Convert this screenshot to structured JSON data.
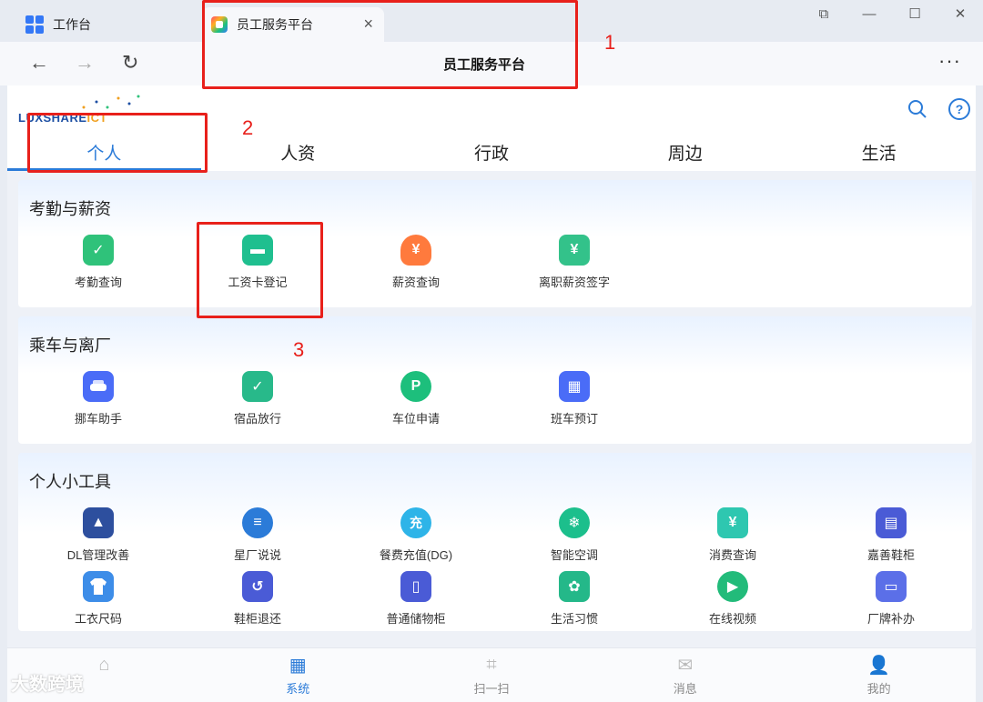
{
  "browser": {
    "tabs": [
      {
        "label": "工作台"
      },
      {
        "label": "员工服务平台"
      }
    ],
    "close_symbol": "×",
    "page_title": "员工服务平台",
    "more_symbol": "···",
    "nav": {
      "back": "←",
      "forward": "→",
      "reload": "↻"
    },
    "window_controls": {
      "restore": "⧉",
      "minimize": "—",
      "maximize": "☐",
      "close": "✕"
    }
  },
  "header": {
    "logo_main": "LUXSHARE",
    "logo_suffix": "ICT",
    "search_symbol": "⌕",
    "help_symbol": "?"
  },
  "top_tabs": [
    {
      "label": "个人",
      "active": true
    },
    {
      "label": "人资",
      "active": false
    },
    {
      "label": "行政",
      "active": false
    },
    {
      "label": "周边",
      "active": false
    },
    {
      "label": "生活",
      "active": false
    }
  ],
  "sections": [
    {
      "title": "考勤与薪资",
      "items": [
        {
          "label": "考勤查询",
          "icon": "calendar-check-icon",
          "glyph": "✓",
          "color": "#2fc27a"
        },
        {
          "label": "工资卡登记",
          "icon": "bank-card-icon",
          "glyph": "▬",
          "color": "#1fbf8f"
        },
        {
          "label": "薪资查询",
          "icon": "money-bag-icon",
          "glyph": "¥",
          "color": "#ff7a3d"
        },
        {
          "label": "离职薪资签字",
          "icon": "sign-document-icon",
          "glyph": "¥",
          "color": "#33c28a"
        }
      ]
    },
    {
      "title": "乘车与离厂",
      "items": [
        {
          "label": "挪车助手",
          "icon": "car-icon",
          "glyph": "🚗",
          "color": "#4a6cf7"
        },
        {
          "label": "宿品放行",
          "icon": "package-check-icon",
          "glyph": "✓",
          "color": "#28b98a"
        },
        {
          "label": "车位申请",
          "icon": "parking-icon",
          "glyph": "P",
          "color": "#1dbf7c"
        },
        {
          "label": "班车预订",
          "icon": "bus-icon",
          "glyph": "▦",
          "color": "#4a6cf7"
        }
      ]
    },
    {
      "title": "个人小工具",
      "items": [
        {
          "label": "DL管理改善",
          "icon": "building-chart-icon",
          "glyph": "▲",
          "color": "#2d4f9e"
        },
        {
          "label": "星厂说说",
          "icon": "chat-bubble-icon",
          "glyph": "≡",
          "color": "#2b7bd8"
        },
        {
          "label": "餐费充值(DG)",
          "icon": "recharge-icon",
          "glyph": "充",
          "color": "#2eb4e8"
        },
        {
          "label": "智能空调",
          "icon": "air-conditioner-icon",
          "glyph": "❄",
          "color": "#1cbf8c"
        },
        {
          "label": "消费查询",
          "icon": "receipt-icon",
          "glyph": "¥",
          "color": "#2ec7b0"
        },
        {
          "label": "嘉善鞋柜",
          "icon": "cabinet-icon",
          "glyph": "▤",
          "color": "#4a5bd6"
        },
        {
          "label": "工衣尺码",
          "icon": "uniform-icon",
          "glyph": "👕",
          "color": "#3d8de8"
        },
        {
          "label": "鞋柜退还",
          "icon": "cabinet-return-icon",
          "glyph": "↺",
          "color": "#4a5bd6"
        },
        {
          "label": "普通储物柜",
          "icon": "locker-key-icon",
          "glyph": "▯",
          "color": "#4a5bd6"
        },
        {
          "label": "生活习惯",
          "icon": "plant-icon",
          "glyph": "✿",
          "color": "#24b889"
        },
        {
          "label": "在线视频",
          "icon": "video-cloud-icon",
          "glyph": "▶",
          "color": "#22bb7a"
        },
        {
          "label": "厂牌补办",
          "icon": "id-card-icon",
          "glyph": "▭",
          "color": "#5b6fe8"
        }
      ]
    }
  ],
  "bottom_nav": [
    {
      "label": "",
      "icon": "home-icon",
      "glyph": "⌂",
      "active": false
    },
    {
      "label": "系统",
      "icon": "apps-icon",
      "glyph": "▦",
      "active": true
    },
    {
      "label": "扫一扫",
      "icon": "scan-icon",
      "glyph": "⌗",
      "active": false
    },
    {
      "label": "消息",
      "icon": "message-icon",
      "glyph": "✉",
      "active": false
    },
    {
      "label": "我的",
      "icon": "user-icon",
      "glyph": "👤",
      "active": false
    }
  ],
  "annotations": [
    "1",
    "2",
    "3"
  ],
  "watermark": "大数跨境",
  "colors": {
    "accent": "#2b7bd8",
    "annotation": "#e8201b"
  }
}
